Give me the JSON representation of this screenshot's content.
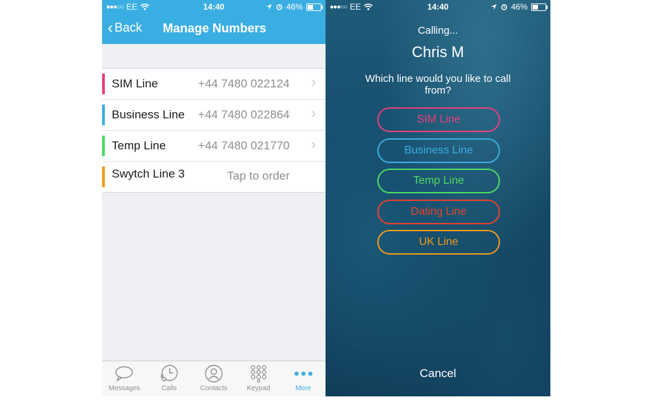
{
  "status_left": {
    "carrier": "EE",
    "time": "14:40",
    "battery_text": "46%",
    "battery_level": 0.46
  },
  "status_right": {
    "carrier": "EE",
    "time": "14:40",
    "battery_text": "46%",
    "battery_level": 0.46
  },
  "manage": {
    "back_label": "Back",
    "title": "Manage Numbers",
    "accent": "#3aaee2",
    "lines": [
      {
        "name": "SIM Line",
        "number": "+44 7480 022124",
        "color": "#e8407a"
      },
      {
        "name": "Business Line",
        "number": "+44 7480 022864",
        "color": "#3aaee2"
      },
      {
        "name": "Temp Line",
        "number": "+44 7480 021770",
        "color": "#4cd964"
      },
      {
        "name": "Swytch Line 3",
        "action": "Tap to order",
        "color": "#f29a1b"
      }
    ],
    "tabs": [
      {
        "label": "Messages",
        "icon": "message-bubble-icon"
      },
      {
        "label": "Calls",
        "icon": "phone-clock-icon"
      },
      {
        "label": "Contacts",
        "icon": "contact-person-icon"
      },
      {
        "label": "Keypad",
        "icon": "keypad-grid-icon"
      },
      {
        "label": "More",
        "icon": "more-dots-icon",
        "active": true
      }
    ]
  },
  "calling": {
    "status": "Calling...",
    "contact": "Chris M",
    "prompt": "Which line would you like to call from?",
    "options": [
      {
        "label": "SIM Line",
        "color": "#e8407a"
      },
      {
        "label": "Business Line",
        "color": "#3aaee2"
      },
      {
        "label": "Temp Line",
        "color": "#4cd964"
      },
      {
        "label": "Dating Line",
        "color": "#e8412d"
      },
      {
        "label": "UK Line",
        "color": "#f29a1b"
      }
    ],
    "cancel": "Cancel"
  }
}
